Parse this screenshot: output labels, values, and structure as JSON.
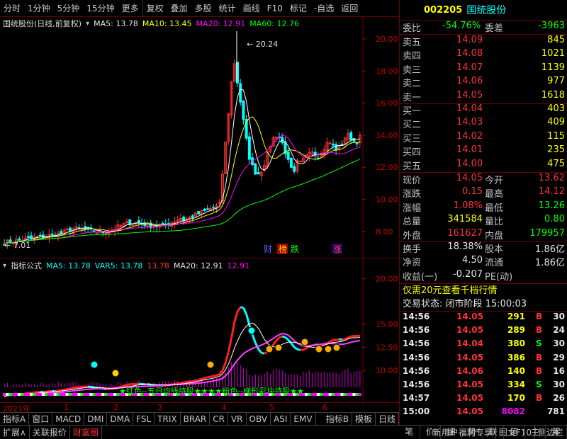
{
  "toolbar": {
    "items": [
      "分时",
      "1分钟",
      "5分钟",
      "15分钟",
      "更多",
      "复权",
      "叠加",
      "多股",
      "统计",
      "画线",
      "F10",
      "标记",
      "-自选",
      "返回"
    ]
  },
  "main_legend": {
    "name": "国统股份(日线,前复权)",
    "ma5": "MA5: 13.78",
    "ma10": "MA10: 13.45",
    "ma20": "MA20: 12.91",
    "ma60": "MA60: 12.76"
  },
  "main_axis": [
    "20.00",
    "18.00",
    "16.00",
    "14.00",
    "12.00",
    "10.00",
    "8.00"
  ],
  "main_labels": {
    "high": "20.24",
    "low": "7.01",
    "markers": [
      "财",
      "榜",
      "跌",
      "涨"
    ]
  },
  "ind_legend": {
    "name": "指标公式",
    "ma5": "MA5: 13.78",
    "var5": "VAR5: 13.78",
    "var5b": "13.78",
    "ma20": "MA20: 12.91",
    "ma20b": "12.91"
  },
  "ind_axis": [
    "20.00",
    "15.00",
    "12.50",
    "10.00"
  ],
  "ind_strategy": "★红色--五日均线持股★★★★粉色--梯形彩块持股★★",
  "date_axis": [
    "2021年",
    "1",
    "2",
    "3",
    "4",
    "5",
    "6"
  ],
  "tabs1": [
    "指标A",
    "窗口",
    "MACD",
    "DMI",
    "DMA",
    "FSL",
    "TRIX",
    "BRAR",
    "CR",
    "VR",
    "OBV",
    "ASI",
    "EMV"
  ],
  "tabs1_right": [
    "指标B",
    "模板",
    "日线"
  ],
  "tabs2": [
    "扩展∧",
    "关联报价",
    "财富圈",
    "新用户福利专享",
    "图文F10",
    "侧边栏"
  ],
  "tabs2_right": [
    "笔",
    "价",
    "细",
    "势",
    "联",
    "值",
    "主",
    "筹"
  ],
  "quote": {
    "code": "002205",
    "name": "国统股份",
    "weibi_label": "委比",
    "weibi": "-54.76%",
    "weicha_label": "委差",
    "weicha": "-3963",
    "asks": [
      {
        "label": "卖五",
        "price": "14.09",
        "vol": "845"
      },
      {
        "label": "卖四",
        "price": "14.08",
        "vol": "1021"
      },
      {
        "label": "卖三",
        "price": "14.07",
        "vol": "1139"
      },
      {
        "label": "卖二",
        "price": "14.06",
        "vol": "977"
      },
      {
        "label": "卖一",
        "price": "14.05",
        "vol": "1618"
      }
    ],
    "bids": [
      {
        "label": "买一",
        "price": "14.04",
        "vol": "403"
      },
      {
        "label": "买二",
        "price": "14.03",
        "vol": "409"
      },
      {
        "label": "买三",
        "price": "14.02",
        "vol": "115"
      },
      {
        "label": "买四",
        "price": "14.01",
        "vol": "235"
      },
      {
        "label": "买五",
        "price": "14.00",
        "vol": "475"
      }
    ],
    "stats": [
      {
        "l1": "现价",
        "v1": "14.05",
        "c1": "red",
        "l2": "今开",
        "v2": "13.62",
        "c2": "red"
      },
      {
        "l1": "涨跌",
        "v1": "0.15",
        "c1": "red",
        "l2": "最高",
        "v2": "14.12",
        "c2": "red"
      },
      {
        "l1": "涨幅",
        "v1": "1.08%",
        "c1": "red",
        "l2": "最低",
        "v2": "13.26",
        "c2": "green"
      },
      {
        "l1": "总量",
        "v1": "341584",
        "c1": "yellow",
        "l2": "量比",
        "v2": "0.80",
        "c2": "green"
      },
      {
        "l1": "外盘",
        "v1": "161627",
        "c1": "red",
        "l2": "内盘",
        "v2": "179957",
        "c2": "green"
      }
    ],
    "stats2": [
      {
        "l1": "换手",
        "v1": "18.38%",
        "l2": "股本",
        "v2": "1.86亿"
      },
      {
        "l1": "净资",
        "v1": "4.50",
        "l2": "流通",
        "v2": "1.86亿"
      },
      {
        "l1": "收益(一)",
        "v1": "-0.207",
        "l2": "PE(动)",
        "v2": ""
      }
    ],
    "promo": "仅需20元查看千档行情",
    "status_label": "交易状态:",
    "status_value": "闭市阶段",
    "status_time": "15:00:03",
    "ticks": [
      {
        "t": "14:56",
        "p": "14.05",
        "v": "291",
        "bs": "B",
        "n": "30"
      },
      {
        "t": "14:56",
        "p": "14.05",
        "v": "289",
        "bs": "B",
        "n": "24"
      },
      {
        "t": "14:56",
        "p": "14.04",
        "v": "380",
        "bs": "S",
        "n": "30"
      },
      {
        "t": "14:56",
        "p": "14.05",
        "v": "386",
        "bs": "B",
        "n": "29"
      },
      {
        "t": "14:56",
        "p": "14.06",
        "v": "140",
        "bs": "B",
        "n": "16"
      },
      {
        "t": "14:56",
        "p": "14.05",
        "v": "334",
        "bs": "S",
        "n": "30"
      },
      {
        "t": "14:57",
        "p": "14.05",
        "v": "170",
        "bs": "B",
        "n": "26"
      },
      {
        "t": "15:00",
        "p": "14.05",
        "v": "8082",
        "bs": "",
        "n": "781"
      }
    ]
  },
  "colors": {
    "up": "#ff3232",
    "down": "#00ffff",
    "ma5": "#ffffff",
    "ma10": "#ffff00",
    "ma20": "#ff00ff",
    "ma60": "#00ff00",
    "grid": "#6b0000"
  }
}
